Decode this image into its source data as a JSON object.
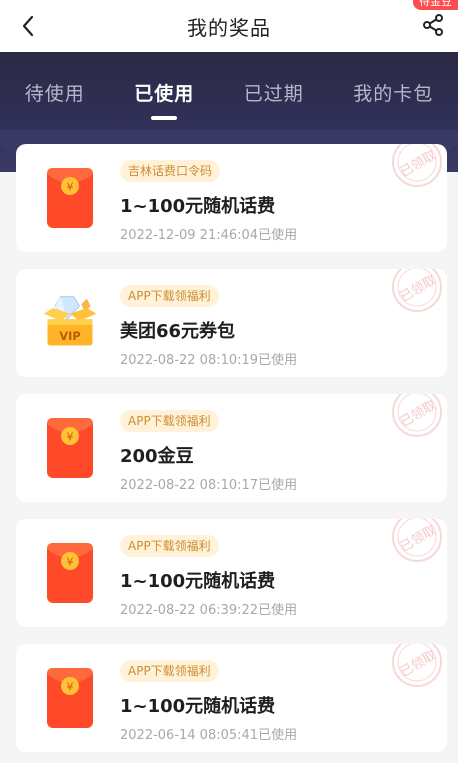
{
  "header": {
    "title": "我的奖品",
    "corner_badge": "待金豆"
  },
  "tabs": [
    {
      "label": "待使用"
    },
    {
      "label": "已使用"
    },
    {
      "label": "已过期"
    },
    {
      "label": "我的卡包"
    }
  ],
  "active_tab": 1,
  "stamp_text": "已领取",
  "colors": {
    "tab_bg": "#2e2d4f",
    "tag_bg": "#fff2d8",
    "tag_text": "#cc8d32",
    "red_packet": "#ff4a2a",
    "coin": "#ffc234"
  },
  "prizes": [
    {
      "tag": "吉林话费口令码",
      "name": "1~100元随机话费",
      "time": "2022-12-09 21:46:04已使用",
      "icon": "red-packet-icon"
    },
    {
      "tag": "APP下载领福利",
      "name": "美团66元券包",
      "time": "2022-08-22 08:10:19已使用",
      "icon": "vip-chest-icon",
      "icon_label": "VIP"
    },
    {
      "tag": "APP下载领福利",
      "name": "200金豆",
      "time": "2022-08-22 08:10:17已使用",
      "icon": "red-packet-icon"
    },
    {
      "tag": "APP下载领福利",
      "name": "1~100元随机话费",
      "time": "2022-08-22 06:39:22已使用",
      "icon": "red-packet-icon"
    },
    {
      "tag": "APP下载领福利",
      "name": "1~100元随机话费",
      "time": "2022-06-14 08:05:41已使用",
      "icon": "red-packet-icon"
    }
  ]
}
